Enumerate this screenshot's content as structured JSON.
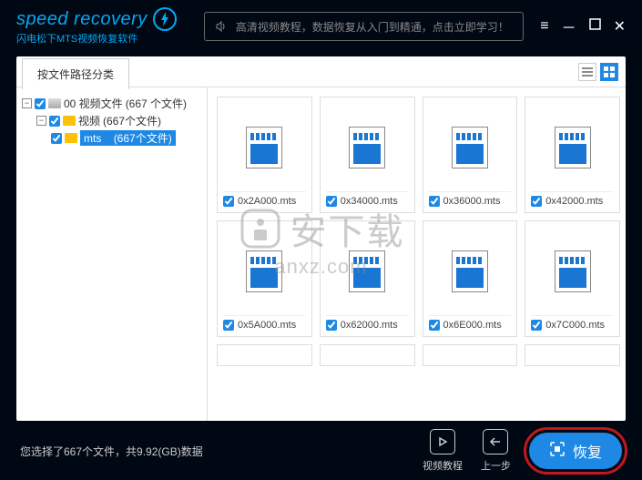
{
  "header": {
    "logo_text": "speed recovery",
    "logo_sub": "闪电松下MTS视频恢复软件",
    "tip_text": "高清视频教程，数据恢复从入门到精通，点击立即学习！"
  },
  "tabs": {
    "path_tab": "按文件路径分类"
  },
  "tree": {
    "root": {
      "label": "00 视频文件",
      "count": "(667 个文件)"
    },
    "child1": {
      "label": "视频",
      "count": "(667个文件)"
    },
    "child2": {
      "label": "mts",
      "count": "(667个文件)"
    }
  },
  "files": [
    {
      "name": "0x2A000.mts"
    },
    {
      "name": "0x34000.mts"
    },
    {
      "name": "0x36000.mts"
    },
    {
      "name": "0x42000.mts"
    },
    {
      "name": "0x5A000.mts"
    },
    {
      "name": "0x62000.mts"
    },
    {
      "name": "0x6E000.mts"
    },
    {
      "name": "0x7C000.mts"
    }
  ],
  "footer": {
    "status": "您选择了667个文件，共9.92(GB)数据",
    "tutorial_label": "视频教程",
    "back_label": "上一步",
    "recover_label": "恢复"
  },
  "watermark": {
    "cn": "安下载",
    "en": "anxz.com"
  }
}
